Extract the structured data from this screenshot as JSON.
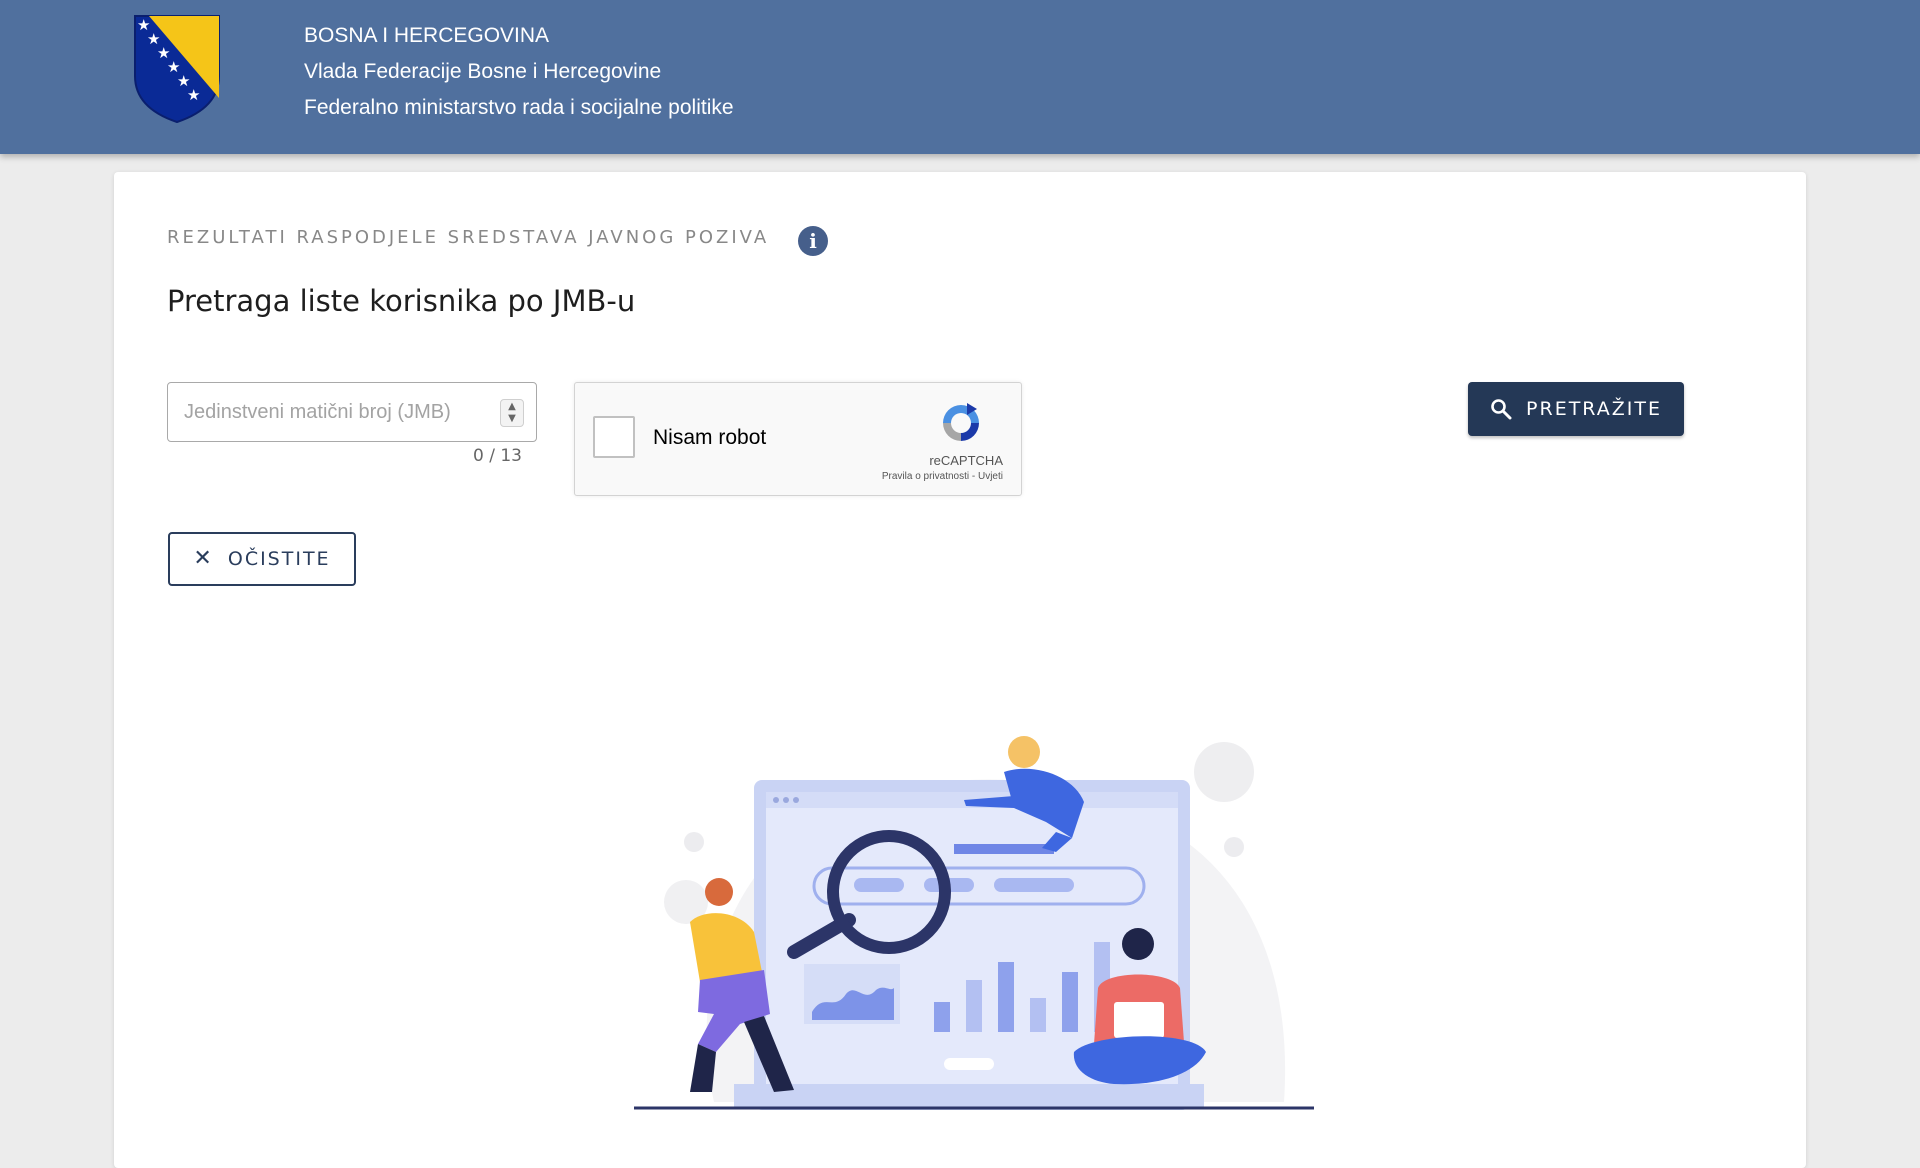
{
  "header": {
    "line1": "BOSNA I HERCEGOVINA",
    "line2": "Vlada Federacije Bosne i Hercegovine",
    "line3": "Federalno ministarstvo rada i socijalne politike",
    "logo_icon": "coat-of-arms-icon",
    "background_color": "#50709e"
  },
  "main": {
    "section_label": "REZULTATI RASPODJELE SREDSTAVA JAVNOG POZIVA",
    "info_icon": "info-icon",
    "title": "Pretraga liste korisnika po JMB-u"
  },
  "form": {
    "jmb_placeholder": "Jedinstveni matični broj (JMB)",
    "jmb_value": "",
    "counter": "0 / 13",
    "captcha_label": "Nisam robot",
    "captcha_brand": "reCAPTCHA",
    "captcha_links": "Pravila o privatnosti - Uvjeti",
    "search_label": "PRETRAŽITE",
    "search_icon": "search-icon",
    "clear_label": "OČISTITE",
    "clear_icon": "close-icon",
    "primary_color": "#243856"
  }
}
